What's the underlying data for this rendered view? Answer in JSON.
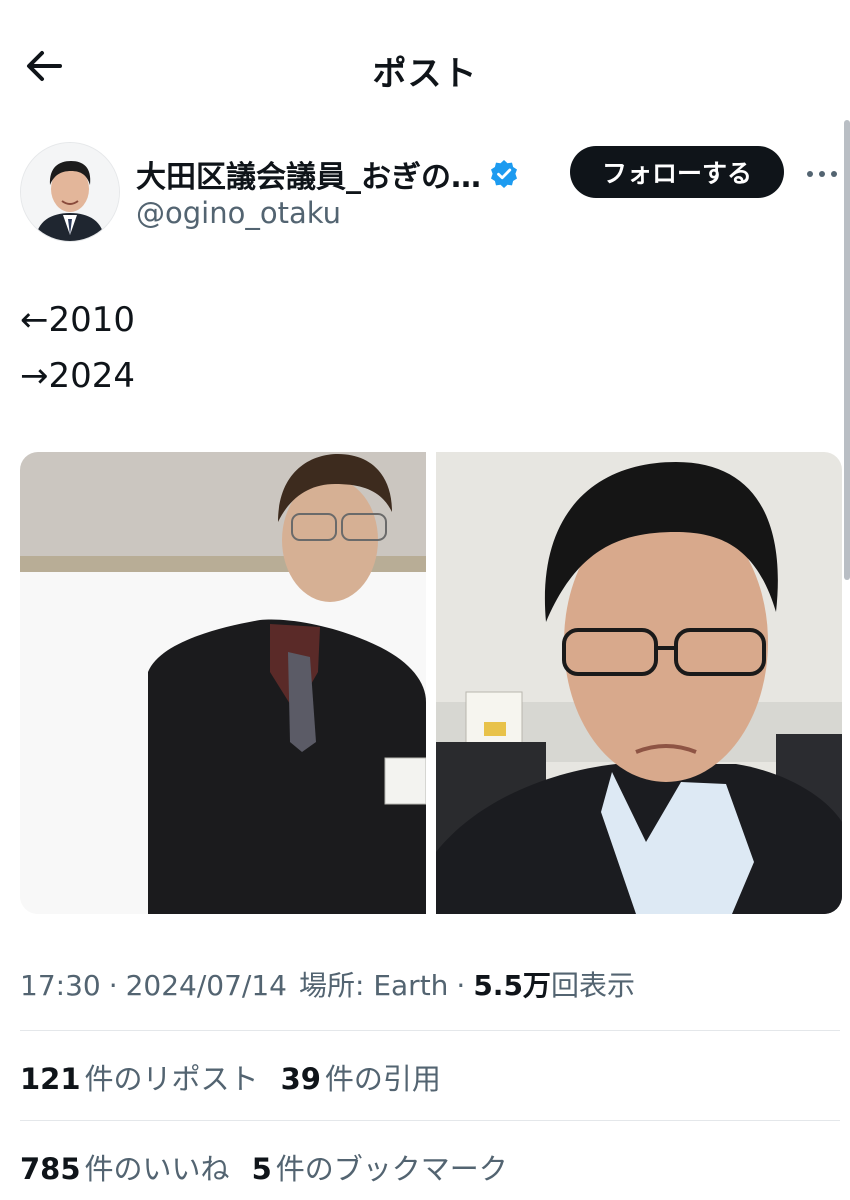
{
  "header": {
    "title": "ポスト",
    "back_icon": "arrow-left-icon"
  },
  "author": {
    "display_name": "大田区議会議員_おぎの…",
    "handle": "@ogino_otaku",
    "verified": true,
    "follow_label": "フォローする",
    "more_icon": "more-icon"
  },
  "post": {
    "lines": [
      "←2010",
      "→2024"
    ]
  },
  "media": {
    "count": 2
  },
  "meta": {
    "time": "17:30",
    "date": "2024/07/14",
    "location": "場所: Earth",
    "views_count": "5.5万",
    "views_label": "回表示"
  },
  "stats": {
    "reposts": {
      "count": "121",
      "label": "件のリポスト"
    },
    "quotes": {
      "count": "39",
      "label": "件の引用"
    },
    "likes": {
      "count": "785",
      "label": "件のいいね"
    },
    "bookmarks": {
      "count": "5",
      "label": "件のブックマーク"
    }
  },
  "colors": {
    "text": "#0f1419",
    "secondary": "#536471",
    "verified": "#1d9bf0",
    "button": "#0f1419"
  }
}
